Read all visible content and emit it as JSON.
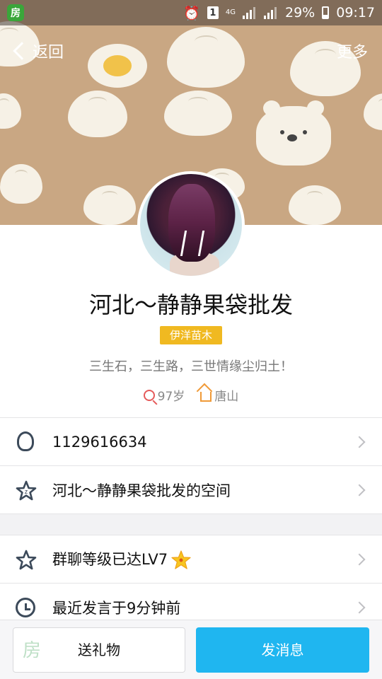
{
  "status_bar": {
    "app_badge": "房",
    "network": "4G",
    "sim": "1",
    "battery": "29%",
    "time": "09:17"
  },
  "nav": {
    "back_label": "返回",
    "more_label": "更多"
  },
  "profile": {
    "name": "河北～静静果袋批发",
    "tag": "伊洋苗木",
    "signature": "三生石，三生路，三世情缘尘归土！",
    "age": "97岁",
    "location": "唐山"
  },
  "info_rows": [
    {
      "label": "1129616634",
      "icon": "penguin-icon"
    },
    {
      "label": "河北～静静果袋批发的空间",
      "icon": "star-icon"
    }
  ],
  "stat_rows": [
    {
      "label": "群聊等级已达LV7",
      "icon": "star-outline-icon"
    },
    {
      "label": "最近发言于9分钟前",
      "icon": "clock-icon"
    }
  ],
  "actions": {
    "gift_label": "送礼物",
    "gift_watermark": "房",
    "message_label": "发消息"
  },
  "colors": {
    "accent_blue": "#1fb6f0",
    "tag_yellow": "#f0b921",
    "cover_tan": "#c9a783"
  }
}
